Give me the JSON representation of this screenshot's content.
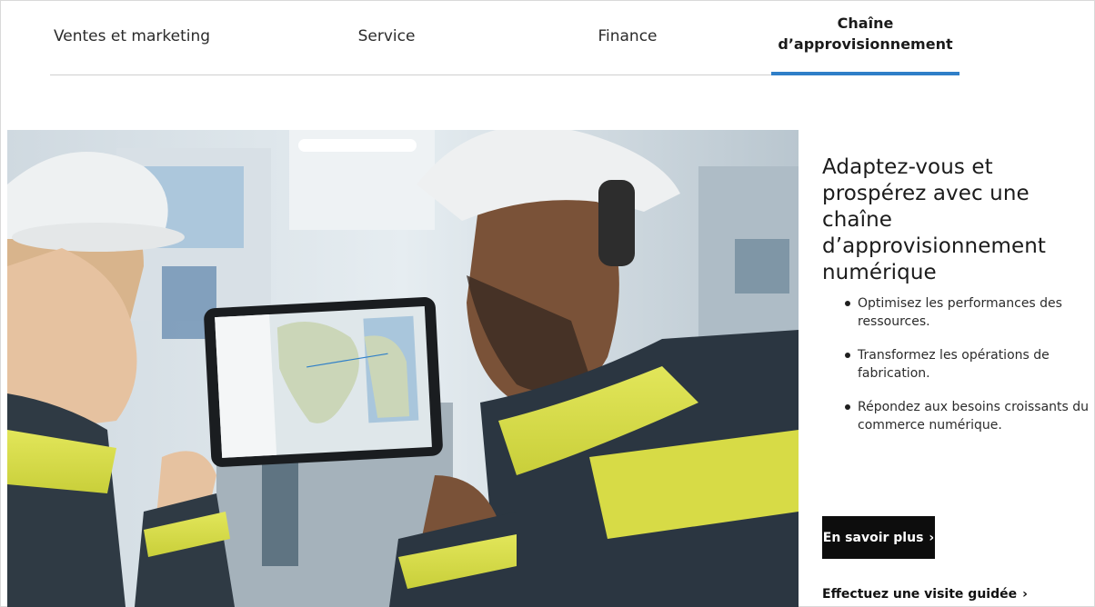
{
  "tabs": [
    {
      "label": "Ventes et marketing",
      "active": false
    },
    {
      "label": "Service",
      "active": false
    },
    {
      "label": "Finance",
      "active": false
    },
    {
      "label_line1": "Chaîne",
      "label_line2": "d’approvisionnement",
      "active": true
    }
  ],
  "hero": {
    "headline": "Adaptez-vous et prospérez avec une chaîne d’approvisionnement numérique",
    "bullets": [
      "Optimisez les performances des ressources.",
      "Transformez les opérations de fabrication.",
      "Répondez aux besoins croissants du commerce numérique."
    ],
    "cta_label": "En savoir plus",
    "secondary_link": "Effectuez une visite guidée"
  },
  "colors": {
    "accent": "#2f7fc8",
    "cta_bg": "#0d0d0d",
    "text": "#1f1f1f"
  },
  "icons": {
    "cta": "chevron-right-icon",
    "link": "chevron-right-icon"
  }
}
